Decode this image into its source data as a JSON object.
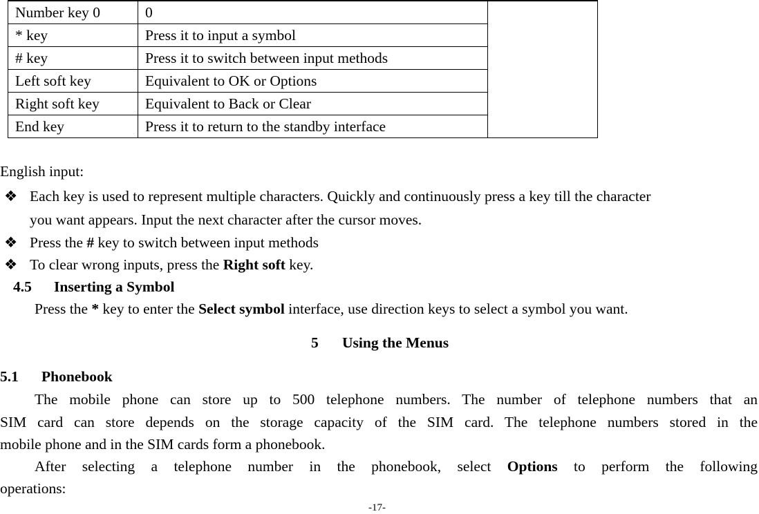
{
  "key_table": {
    "rows": [
      {
        "key": "Number key 0",
        "function": "0"
      },
      {
        "key": "* key",
        "function": "Press it to input a symbol"
      },
      {
        "key": "# key",
        "function": "Press it to switch between input methods"
      },
      {
        "key": "Left soft key",
        "function": "Equivalent to OK or Options"
      },
      {
        "key": "Right soft key",
        "function": "Equivalent to Back or Clear"
      },
      {
        "key": "End key",
        "function": "Press it to return to the standby interface"
      }
    ]
  },
  "english_input": {
    "label": "English input:",
    "bullet_icon": "❖",
    "bullets": [
      {
        "line1": "Each key is used to represent multiple characters. Quickly and continuously press a key till the character",
        "line2": "you want appears. Input the next character after the cursor moves."
      },
      {
        "pre": "Press the ",
        "bold": "#",
        "post": " key to switch between input methods"
      },
      {
        "pre": "To clear wrong inputs, press the ",
        "bold": "Right soft",
        "post": " key."
      }
    ]
  },
  "section_4_5": {
    "number": "4.5",
    "title": "Inserting a Symbol",
    "body_pre": "Press the ",
    "body_bold1": "*",
    "body_mid": " key to enter the ",
    "body_bold2": "Select symbol",
    "body_post": " interface, use direction keys to select a symbol you want."
  },
  "chapter_5": {
    "number": "5",
    "title": "Using the Menus"
  },
  "section_5_1": {
    "number": "5.1",
    "title": "Phonebook",
    "para1": {
      "line1": "The mobile phone can store up to 500 telephone numbers. The number of telephone numbers that an",
      "line2": "SIM card can store depends on the storage capacity of the SIM card. The telephone numbers stored in the",
      "line3": "mobile phone and in the SIM cards form a phonebook."
    },
    "para2": {
      "pre": "After selecting a telephone number in the phonebook, select ",
      "bold": "Options",
      "post": " to perform the following",
      "line2": "operations:"
    }
  },
  "footer": {
    "page_number": "-17-"
  }
}
